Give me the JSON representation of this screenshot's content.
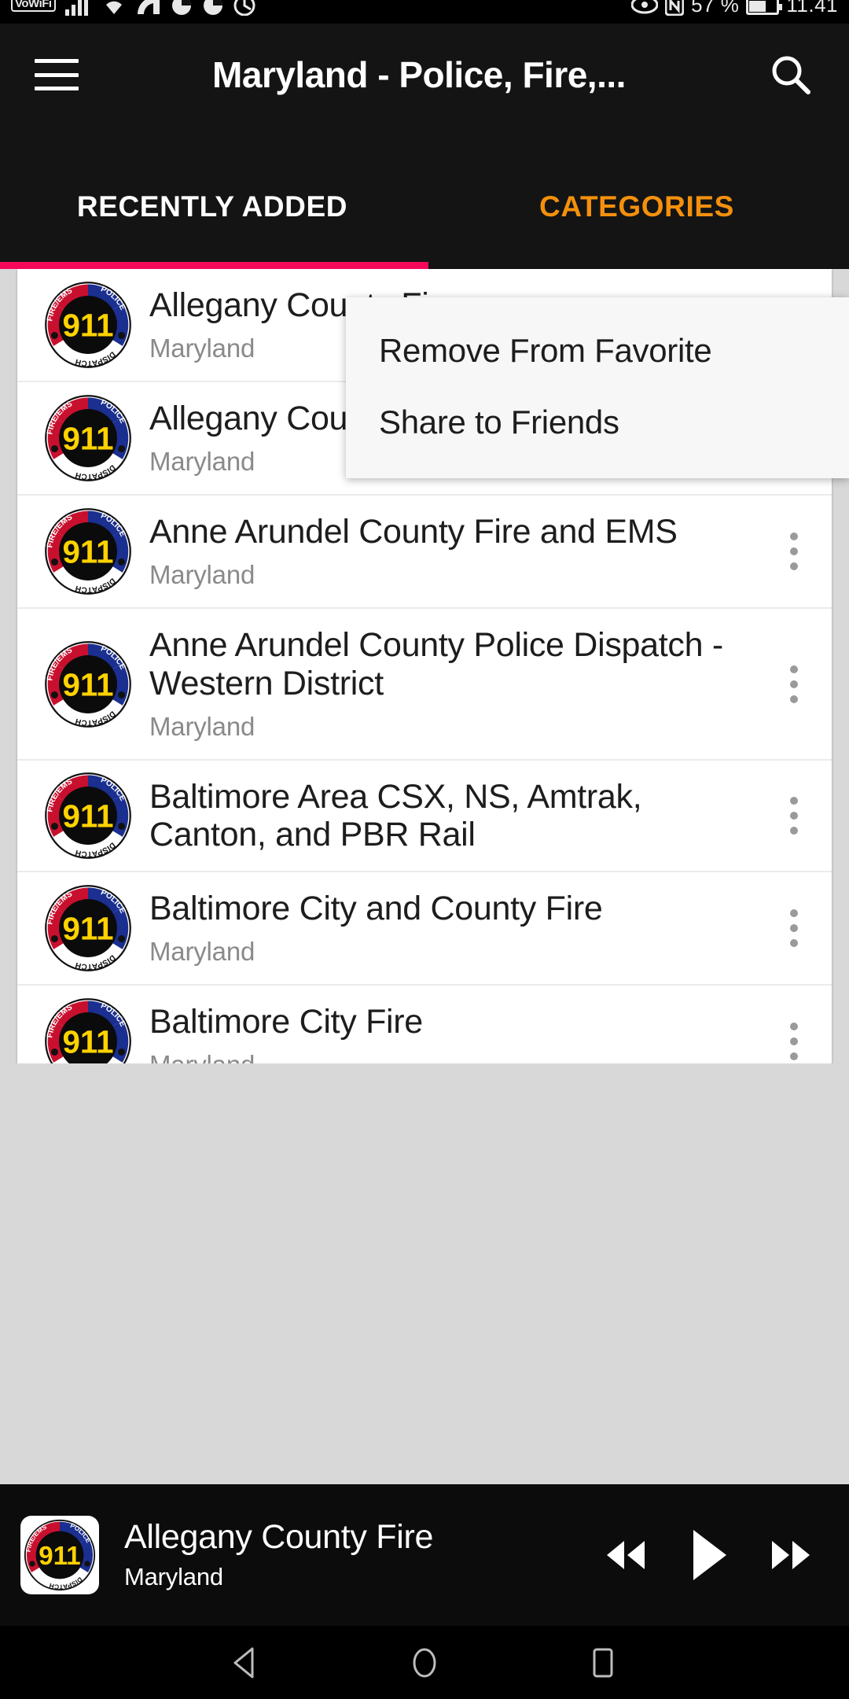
{
  "status_bar": {
    "vowifi_badge": "VoWiFi",
    "battery_percent": "57 %",
    "clock": "11.41",
    "icons": [
      "vowifi-badge",
      "signal-bars-icon",
      "wifi-icon",
      "cast-icon",
      "app-icon-1",
      "app-icon-2",
      "chrome-icon",
      "eye-icon",
      "nfc-icon",
      "battery-icon"
    ]
  },
  "app_bar": {
    "menu_icon": "hamburger-menu-icon",
    "title": "Maryland - Police, Fire,...",
    "search_icon": "search-icon"
  },
  "tabs": [
    {
      "label": "RECENTLY ADDED",
      "active": true,
      "color": "#ffffff"
    },
    {
      "label": "CATEGORIES",
      "active": false,
      "color": "#f4900c"
    }
  ],
  "tab_indicator_color": "#f5085a",
  "list": {
    "items": [
      {
        "name": "Allegany County Fire",
        "sub": "Maryland"
      },
      {
        "name": "Allegany County Police EMS Dispatch",
        "sub": "Maryland"
      },
      {
        "name": "Anne Arundel County Fire and EMS",
        "sub": "Maryland"
      },
      {
        "name": "Anne Arundel County Police Dispatch - Western District",
        "sub": "Maryland"
      },
      {
        "name": "Baltimore Area CSX, NS, Amtrak, Canton, and PBR Rail",
        "sub": "Maryland"
      },
      {
        "name": "Baltimore City and County Fire",
        "sub": "Maryland"
      },
      {
        "name": "Baltimore City Fire",
        "sub": "Maryland"
      }
    ]
  },
  "popup_menu": {
    "items": [
      {
        "label": "Remove From Favorite"
      },
      {
        "label": "Share to Friends"
      }
    ]
  },
  "player": {
    "title": "Allegany County Fire",
    "subtitle": "Maryland",
    "controls": [
      {
        "name": "rewind-button",
        "label": "Rewind"
      },
      {
        "name": "play-button",
        "label": "Play"
      },
      {
        "name": "fast-forward-button",
        "label": "Fast forward"
      }
    ]
  },
  "nav_bar": {
    "back": "back-button",
    "home": "home-button",
    "recents": "recents-button"
  },
  "logo": {
    "top_left_text": "FIRE/EMS",
    "top_right_text": "POLICE",
    "center_text": "911",
    "bottom_text": "DISPATCH"
  }
}
